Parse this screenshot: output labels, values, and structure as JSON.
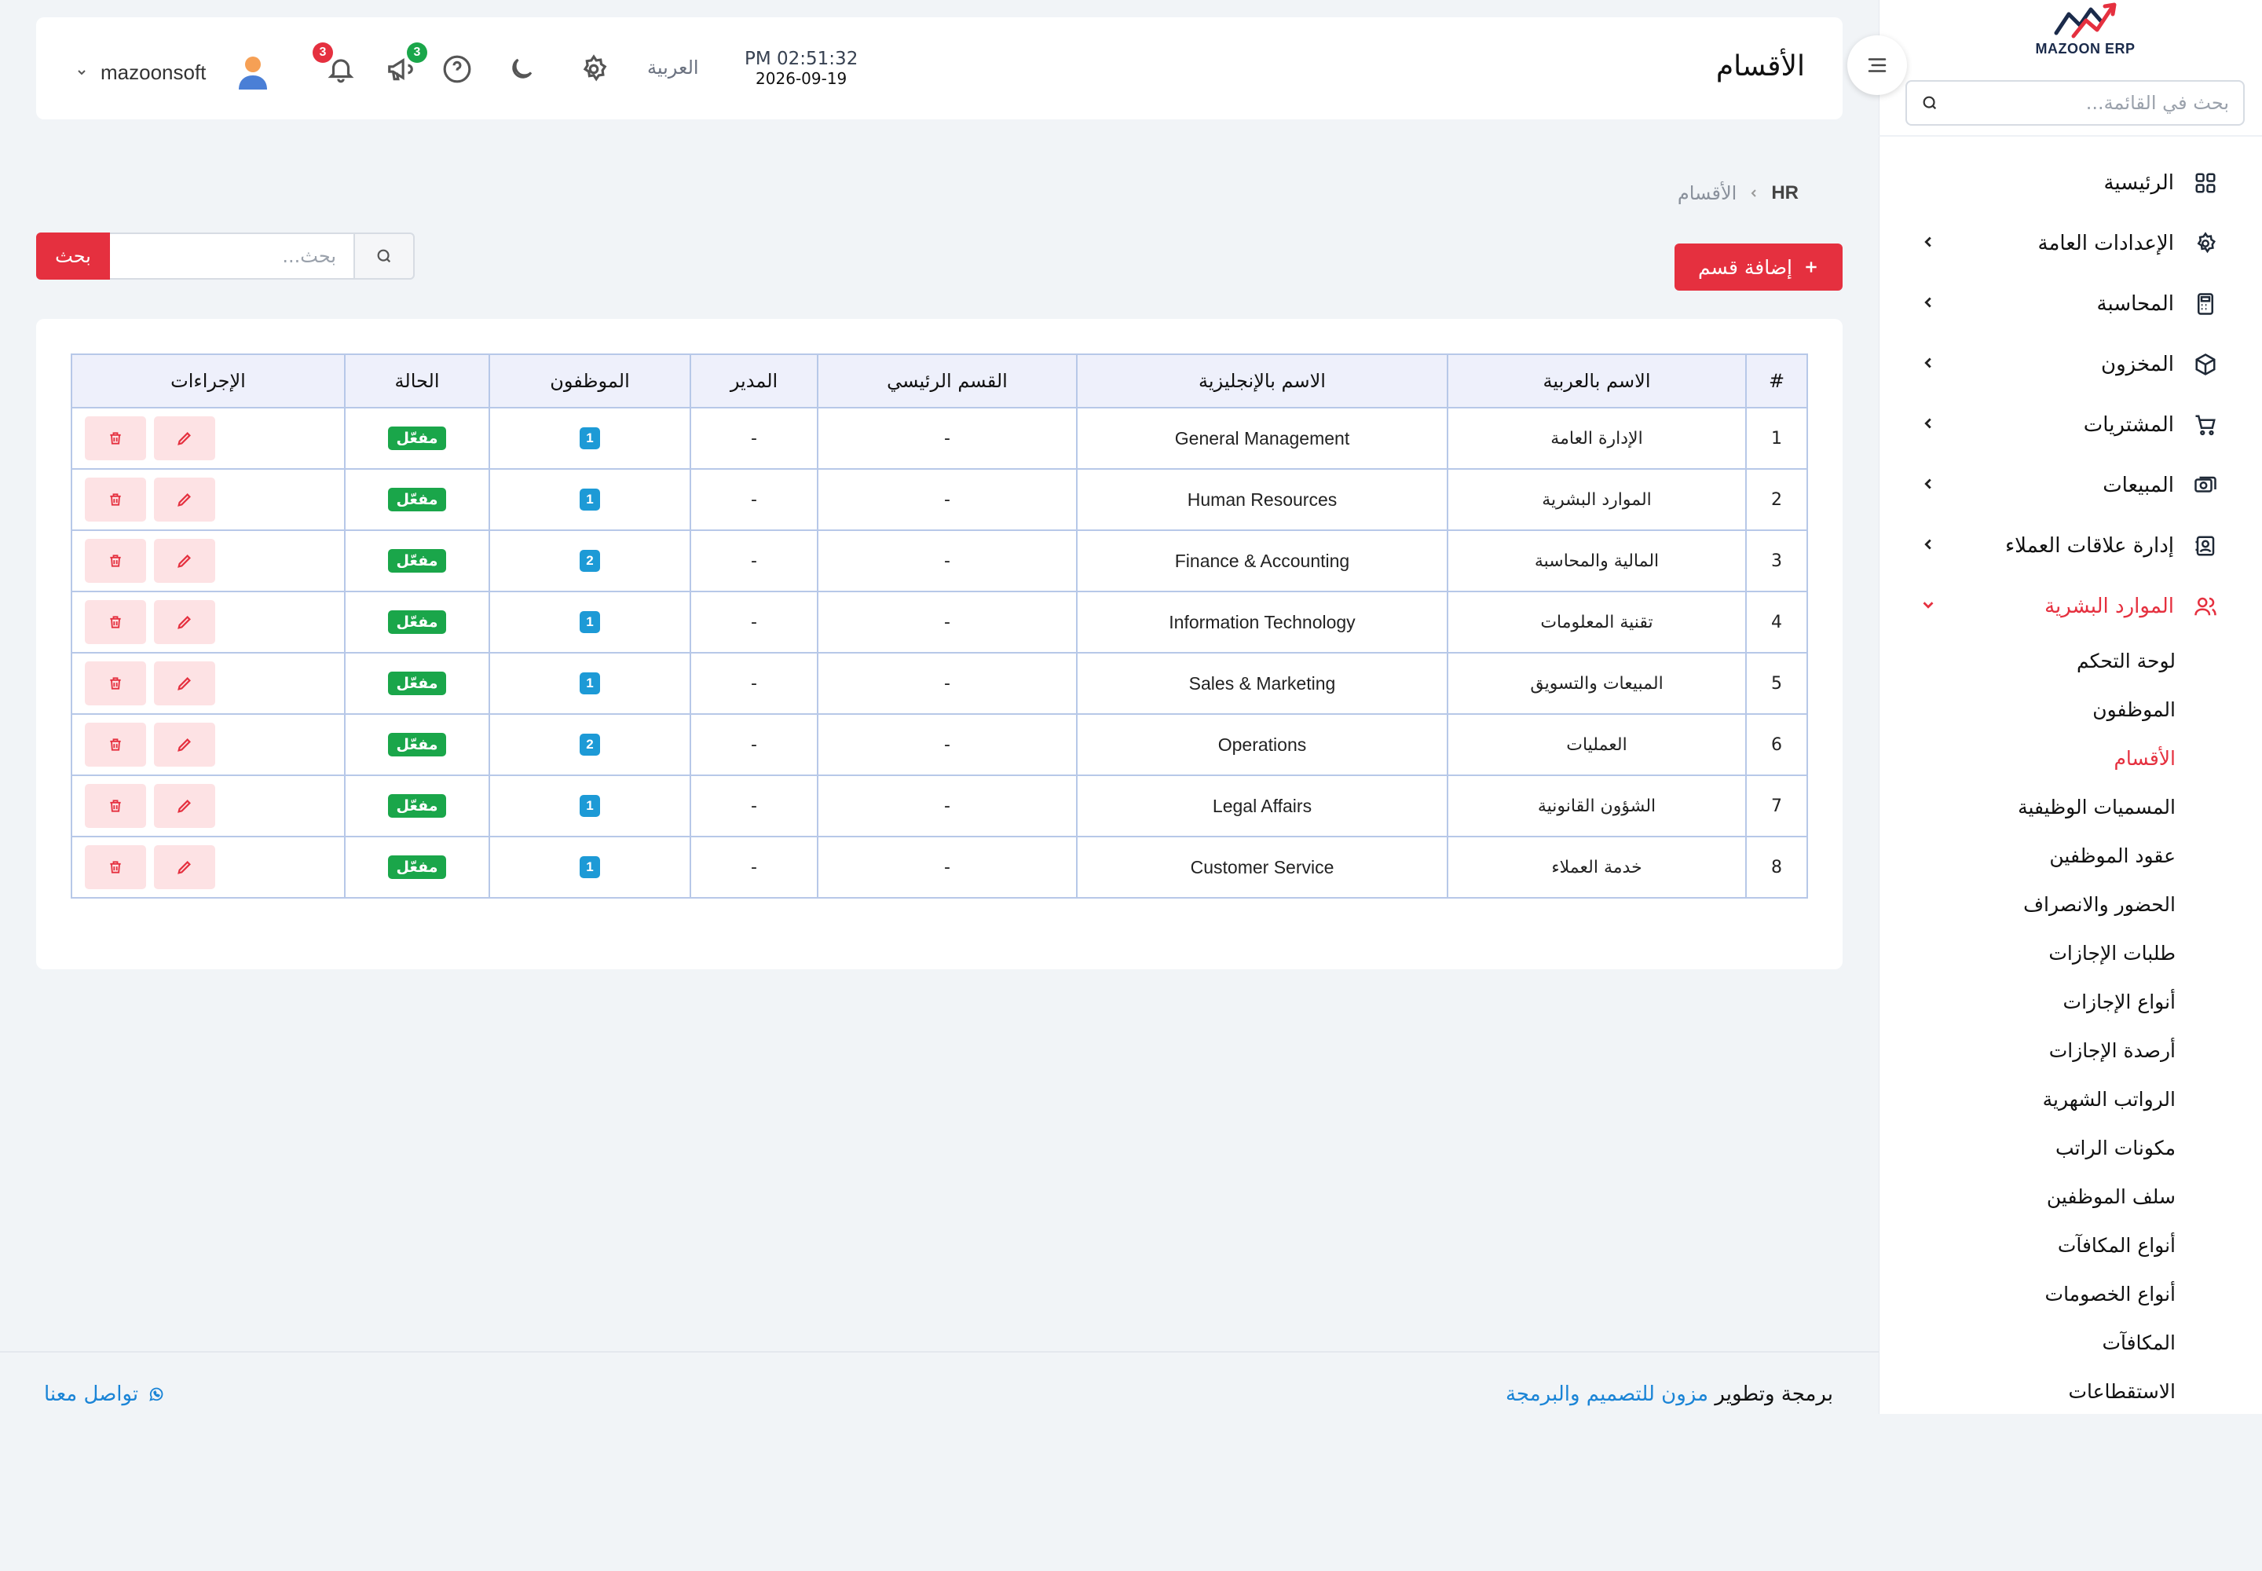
{
  "sidebar": {
    "logo_text": "MAZOON ERP",
    "search_placeholder": "بحث في القائمة...",
    "items": [
      {
        "label": "الرئيسية",
        "icon": "grid-icon"
      },
      {
        "label": "الإعدادات العامة",
        "icon": "gear-icon"
      },
      {
        "label": "المحاسبة",
        "icon": "calculator-icon"
      },
      {
        "label": "المخزون",
        "icon": "box-icon"
      },
      {
        "label": "المشتريات",
        "icon": "cart-icon"
      },
      {
        "label": "المبيعات",
        "icon": "cash-icon"
      },
      {
        "label": "إدارة علاقات العملاء",
        "icon": "contacts-icon"
      },
      {
        "label": "الموارد البشرية",
        "icon": "users-icon"
      }
    ],
    "hr_subitems": [
      "لوحة التحكم",
      "الموظفون",
      "الأقسام",
      "المسميات الوظيفية",
      "عقود الموظفين",
      "الحضور والانصراف",
      "طلبات الإجازات",
      "أنواع الإجازات",
      "أرصدة الإجازات",
      "الرواتب الشهرية",
      "مكونات الراتب",
      "سلف الموظفين",
      "أنواع المكافآت",
      "أنواع الخصومات",
      "المكافآت",
      "الاستقطاعات"
    ],
    "active_subitem": "الأقسام"
  },
  "header": {
    "title": "الأقسام",
    "time": "PM 02:51:32",
    "date": "2026-09-19",
    "language": "العربية",
    "notifications_count": "3",
    "announcements_count": "3",
    "username": "mazoonsoft"
  },
  "breadcrumb": {
    "home": "HR",
    "current": "الأقسام"
  },
  "toolbar": {
    "add_label": "إضافة قسم",
    "search_placeholder": "بحث...",
    "search_button": "بحث"
  },
  "table": {
    "headers": [
      "#",
      "الاسم بالعربية",
      "الاسم بالإنجليزية",
      "القسم الرئيسي",
      "المدير",
      "الموظفون",
      "الحالة",
      "الإجراءات"
    ],
    "rows": [
      {
        "num": "1",
        "ar": "الإدارة العامة",
        "en": "General Management",
        "parent": "-",
        "manager": "-",
        "employees": "1",
        "status": "مفعّل"
      },
      {
        "num": "2",
        "ar": "الموارد البشرية",
        "en": "Human Resources",
        "parent": "-",
        "manager": "-",
        "employees": "1",
        "status": "مفعّل"
      },
      {
        "num": "3",
        "ar": "المالية والمحاسبة",
        "en": "Finance & Accounting",
        "parent": "-",
        "manager": "-",
        "employees": "2",
        "status": "مفعّل"
      },
      {
        "num": "4",
        "ar": "تقنية المعلومات",
        "en": "Information Technology",
        "parent": "-",
        "manager": "-",
        "employees": "1",
        "status": "مفعّل"
      },
      {
        "num": "5",
        "ar": "المبيعات والتسويق",
        "en": "Sales & Marketing",
        "parent": "-",
        "manager": "-",
        "employees": "1",
        "status": "مفعّل"
      },
      {
        "num": "6",
        "ar": "العمليات",
        "en": "Operations",
        "parent": "-",
        "manager": "-",
        "employees": "2",
        "status": "مفعّل"
      },
      {
        "num": "7",
        "ar": "الشؤون القانونية",
        "en": "Legal Affairs",
        "parent": "-",
        "manager": "-",
        "employees": "1",
        "status": "مفعّل"
      },
      {
        "num": "8",
        "ar": "خدمة العملاء",
        "en": "Customer Service",
        "parent": "-",
        "manager": "-",
        "employees": "1",
        "status": "مفعّل"
      }
    ]
  },
  "footer": {
    "credit_prefix": "برمجة وتطوير",
    "credit_link": "مزون للتصميم والبرمجة",
    "contact": "تواصل معنا"
  },
  "colors": {
    "accent": "#e5303f",
    "count_badge": "#1d9ad6",
    "status_badge": "#1aa64a",
    "link": "#1a84d6"
  }
}
